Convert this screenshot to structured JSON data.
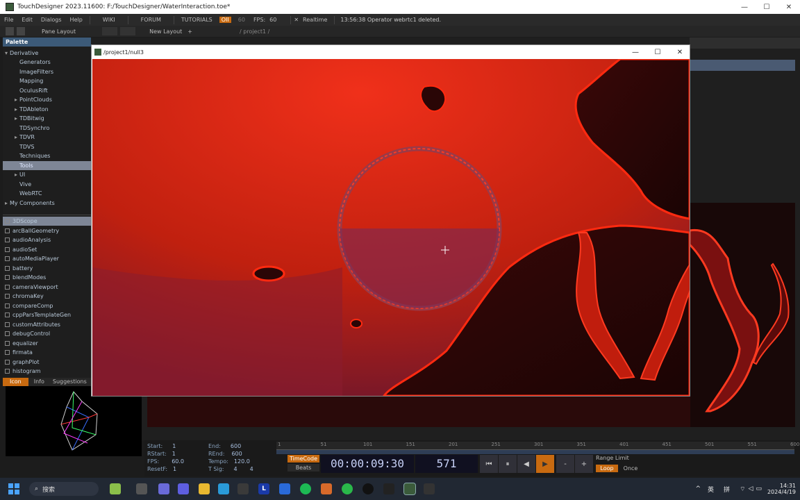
{
  "window": {
    "title": "TouchDesigner 2023.11600: F:/TouchDesigner/WaterInteraction.toe*",
    "controls": [
      "—",
      "☐",
      "✕"
    ]
  },
  "menubar": {
    "file": "File",
    "edit": "Edit",
    "dialogs": "Dialogs",
    "help": "Help",
    "wiki": "WIKI",
    "forum": "FORUM",
    "tutorials": "TUTORIALS",
    "oii": "OII",
    "oii_value": "60",
    "fps_label": "FPS:",
    "fps_value": "60",
    "realtime": "Realtime",
    "status": "13:56:38 Operator webrtc1 deleted."
  },
  "toolbar": {
    "pane_layout": "Pane Layout",
    "new_layout": "New Layout",
    "path": "/ project1 /"
  },
  "palette": {
    "header": "Palette",
    "derivative": "Derivative",
    "folders": [
      {
        "label": "Generators",
        "expandable": false
      },
      {
        "label": "ImageFilters",
        "expandable": false
      },
      {
        "label": "Mapping",
        "expandable": false
      },
      {
        "label": "OculusRift",
        "expandable": false
      },
      {
        "label": "PointClouds",
        "expandable": true
      },
      {
        "label": "TDAbleton",
        "expandable": true
      },
      {
        "label": "TDBitwig",
        "expandable": true
      },
      {
        "label": "TDSynchro",
        "expandable": false
      },
      {
        "label": "TDVR",
        "expandable": true
      },
      {
        "label": "TDVS",
        "expandable": false
      },
      {
        "label": "Techniques",
        "expandable": false
      },
      {
        "label": "Tools",
        "expandable": false
      },
      {
        "label": "UI",
        "expandable": true
      },
      {
        "label": "Vive",
        "expandable": false
      },
      {
        "label": "WebRTC",
        "expandable": false
      }
    ],
    "my_components": "My Components",
    "components": [
      "3DScope",
      "arcBallGeometry",
      "audioAnalysis",
      "audioSet",
      "autoMediaPlayer",
      "battery",
      "blendModes",
      "cameraViewport",
      "chromaKey",
      "compareComp",
      "cppParsTemplateGen",
      "customAttributes",
      "debugControl",
      "equalizer",
      "firmata",
      "graphPlot",
      "histogram"
    ],
    "tabs": [
      "Icon",
      "Info",
      "Suggestions"
    ]
  },
  "floating_window": {
    "title": "/project1/null3",
    "controls": [
      "—",
      "☐",
      "✕"
    ]
  },
  "timeline": {
    "start_label": "Start:",
    "start": "1",
    "end_label": "End:",
    "end": "600",
    "rstart_label": "RStart:",
    "rstart": "1",
    "rend_label": "REnd:",
    "rend": "600",
    "fps_label": "FPS:",
    "fps": "60.0",
    "tempo_label": "Tempo:",
    "tempo": "120.0",
    "resetf_label": "ResetF:",
    "resetf": "1",
    "tsig_label": "T Sig:",
    "tsig_a": "4",
    "tsig_b": "4",
    "ticks": [
      "1",
      "51",
      "101",
      "151",
      "201",
      "251",
      "301",
      "351",
      "401",
      "451",
      "501",
      "551",
      "600"
    ],
    "timecode_btn": "TimeCode",
    "beats_btn": "Beats",
    "timecode": "00:00:09:30",
    "frame": "571",
    "controls": [
      "⏮",
      "⏸",
      "◀",
      "▶",
      "-",
      "+"
    ],
    "range_limit": "Range Limit",
    "loop": "Loop",
    "once": "Once"
  },
  "taskbar": {
    "search": "搜索",
    "lang1": "英",
    "lang2": "拼",
    "time": "14:31",
    "date": "2024/4/19"
  }
}
